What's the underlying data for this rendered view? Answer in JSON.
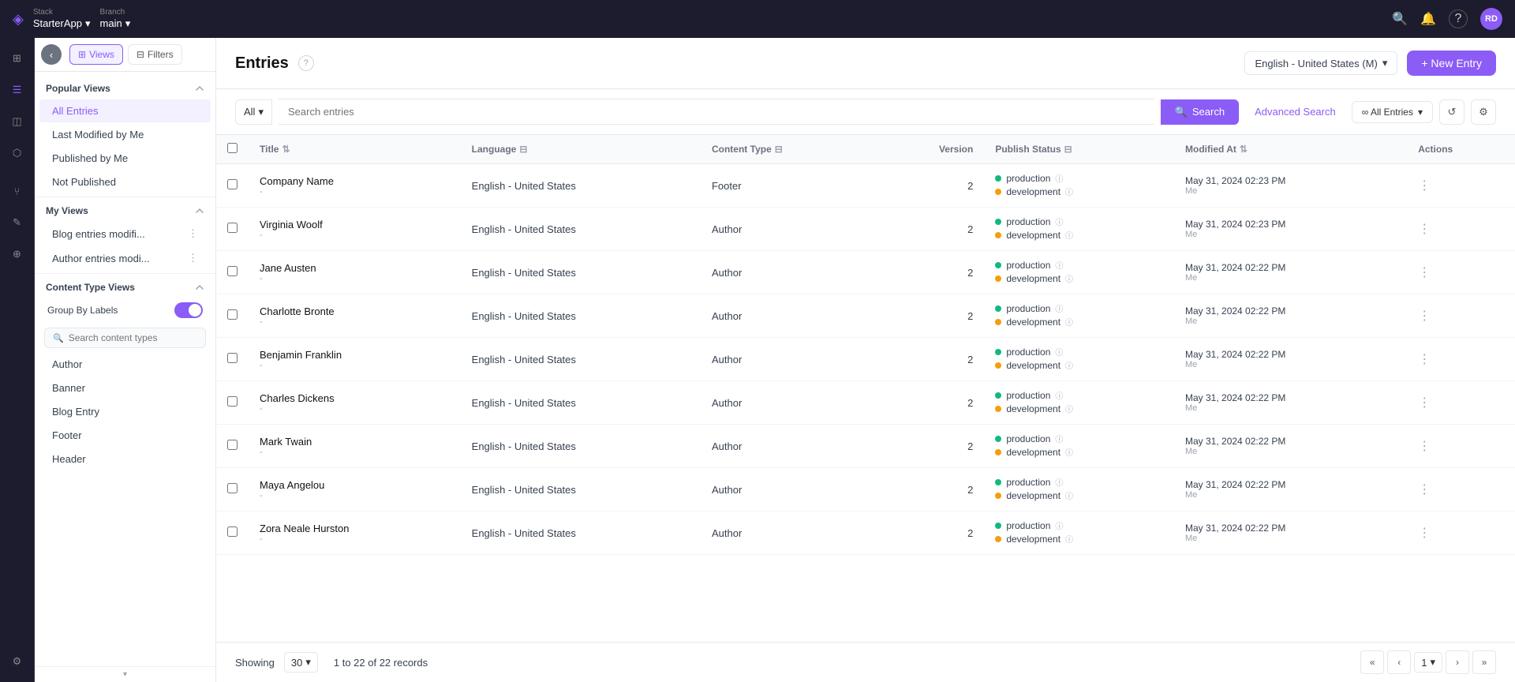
{
  "app": {
    "stack_label": "Stack",
    "stack_name": "StarterApp",
    "branch_label": "Branch",
    "branch_name": "main",
    "user_initials": "RD"
  },
  "left_panel": {
    "views_btn": "Views",
    "filters_btn": "Filters",
    "popular_views_title": "Popular Views",
    "popular_views": [
      {
        "label": "All Entries",
        "active": true
      },
      {
        "label": "Last Modified by Me",
        "active": false
      },
      {
        "label": "Published by Me",
        "active": false
      },
      {
        "label": "Not Published",
        "active": false
      }
    ],
    "my_views_title": "My Views",
    "my_views": [
      {
        "label": "Blog entries modifi..."
      },
      {
        "label": "Author entries modi..."
      }
    ],
    "content_type_views_title": "Content Type Views",
    "group_by_label": "Group By Labels",
    "search_content_types_placeholder": "Search content types",
    "content_types": [
      {
        "label": "Author"
      },
      {
        "label": "Banner"
      },
      {
        "label": "Blog Entry"
      },
      {
        "label": "Footer"
      },
      {
        "label": "Header"
      }
    ]
  },
  "header": {
    "title": "Entries",
    "lang_selector": "English - United States (M)",
    "new_entry_label": "+ New Entry"
  },
  "search": {
    "filter_option": "All",
    "placeholder": "Search entries",
    "search_label": "Search",
    "advanced_search_label": "Advanced Search",
    "all_entries_label": "∞ All Entries"
  },
  "table": {
    "columns": [
      {
        "key": "title",
        "label": "Title"
      },
      {
        "key": "language",
        "label": "Language"
      },
      {
        "key": "content_type",
        "label": "Content Type"
      },
      {
        "key": "version",
        "label": "Version"
      },
      {
        "key": "publish_status",
        "label": "Publish Status"
      },
      {
        "key": "modified_at",
        "label": "Modified At"
      },
      {
        "key": "actions",
        "label": "Actions"
      }
    ],
    "rows": [
      {
        "title": "Company Name",
        "subtitle": "-",
        "language": "English - United States",
        "content_type": "Footer",
        "version": "2",
        "status_production": "production",
        "status_development": "development",
        "modified_at": "May 31, 2024 02:23 PM",
        "modified_by": "Me"
      },
      {
        "title": "Virginia Woolf",
        "subtitle": "-",
        "language": "English - United States",
        "content_type": "Author",
        "version": "2",
        "status_production": "production",
        "status_development": "development",
        "modified_at": "May 31, 2024 02:23 PM",
        "modified_by": "Me"
      },
      {
        "title": "Jane Austen",
        "subtitle": "-",
        "language": "English - United States",
        "content_type": "Author",
        "version": "2",
        "status_production": "production",
        "status_development": "development",
        "modified_at": "May 31, 2024 02:22 PM",
        "modified_by": "Me"
      },
      {
        "title": "Charlotte Bronte",
        "subtitle": "-",
        "language": "English - United States",
        "content_type": "Author",
        "version": "2",
        "status_production": "production",
        "status_development": "development",
        "modified_at": "May 31, 2024 02:22 PM",
        "modified_by": "Me"
      },
      {
        "title": "Benjamin Franklin",
        "subtitle": "-",
        "language": "English - United States",
        "content_type": "Author",
        "version": "2",
        "status_production": "production",
        "status_development": "development",
        "modified_at": "May 31, 2024 02:22 PM",
        "modified_by": "Me"
      },
      {
        "title": "Charles Dickens",
        "subtitle": "-",
        "language": "English - United States",
        "content_type": "Author",
        "version": "2",
        "status_production": "production",
        "status_development": "development",
        "modified_at": "May 31, 2024 02:22 PM",
        "modified_by": "Me"
      },
      {
        "title": "Mark Twain",
        "subtitle": "-",
        "language": "English - United States",
        "content_type": "Author",
        "version": "2",
        "status_production": "production",
        "status_development": "development",
        "modified_at": "May 31, 2024 02:22 PM",
        "modified_by": "Me"
      },
      {
        "title": "Maya Angelou",
        "subtitle": "-",
        "language": "English - United States",
        "content_type": "Author",
        "version": "2",
        "status_production": "production",
        "status_development": "development",
        "modified_at": "May 31, 2024 02:22 PM",
        "modified_by": "Me"
      },
      {
        "title": "Zora Neale Hurston",
        "subtitle": "-",
        "language": "English - United States",
        "content_type": "Author",
        "version": "2",
        "status_production": "production",
        "status_development": "development",
        "modified_at": "May 31, 2024 02:22 PM",
        "modified_by": "Me"
      }
    ]
  },
  "footer": {
    "showing_label": "Showing",
    "per_page": "30",
    "records_info": "1 to 22 of 22 records",
    "current_page": "1"
  },
  "icons": {
    "chevron_down": "▾",
    "chevron_up": "▴",
    "search": "🔍",
    "filter": "⊟",
    "refresh": "↺",
    "settings": "⚙",
    "more": "⋮",
    "back": "‹",
    "grid": "⊞",
    "list": "☰",
    "layers": "⧉",
    "edit": "✎",
    "plugin": "⊕",
    "bell": "🔔",
    "help": "?",
    "info": "ⓘ"
  }
}
